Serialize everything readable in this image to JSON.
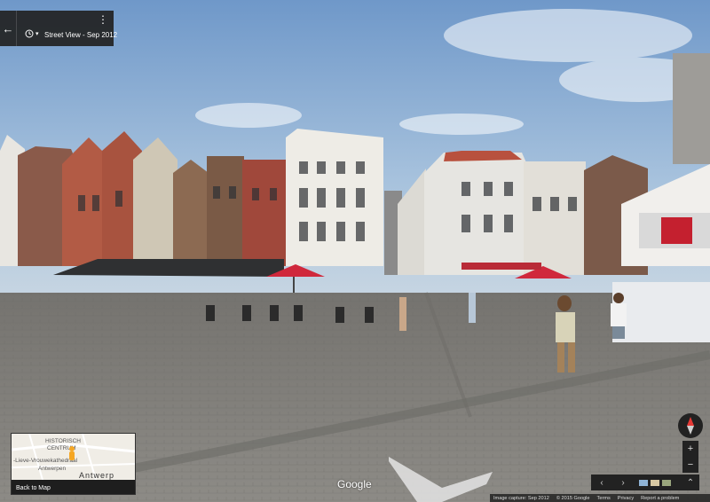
{
  "topbar": {
    "back_icon": "arrow-left-icon",
    "history_icon": "clock-icon",
    "caret": "▾",
    "title": "Street View - Sep 2012",
    "more_icon": "⋮"
  },
  "minimap": {
    "labels": [
      "HISTORISCH",
      "CENTRUM",
      "-Lieve-Vrouwekathedraal",
      "Antwerpen",
      "Antwerp"
    ],
    "back_label": "Back to Map"
  },
  "logo": "Google",
  "controls": {
    "zoom_in": "+",
    "zoom_out": "−",
    "prev": "‹",
    "next": "›",
    "expand": "⌃"
  },
  "footer": {
    "capture": "Image capture: Sep 2012",
    "copyright": "© 2015 Google",
    "terms": "Terms",
    "privacy": "Privacy",
    "report": "Report a problem"
  },
  "colors": {
    "sky": "#8cb2d8",
    "pavement": "#8b8a86",
    "umbrella": "#d0283c",
    "panel": "#222222"
  }
}
